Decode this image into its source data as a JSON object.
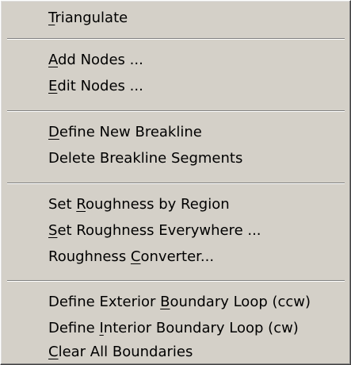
{
  "menu": {
    "items": [
      {
        "pre": "",
        "mn": "T",
        "post": "riangulate"
      },
      {
        "pre": "",
        "mn": "A",
        "post": "dd Nodes ..."
      },
      {
        "pre": "",
        "mn": "E",
        "post": "dit Nodes ..."
      },
      {
        "pre": "",
        "mn": "D",
        "post": "efine New Breakline"
      },
      {
        "pre": "Delete Breakline Segments",
        "mn": "",
        "post": ""
      },
      {
        "pre": "Set ",
        "mn": "R",
        "post": "oughness by Region"
      },
      {
        "pre": "",
        "mn": "S",
        "post": "et Roughness Everywhere ..."
      },
      {
        "pre": "Roughness ",
        "mn": "C",
        "post": "onverter..."
      },
      {
        "pre": "Define Exterior ",
        "mn": "B",
        "post": "oundary Loop (ccw)"
      },
      {
        "pre": "Define ",
        "mn": "I",
        "post": "nterior Boundary Loop (cw)"
      },
      {
        "pre": "",
        "mn": "C",
        "post": "lear All Boundaries"
      }
    ]
  }
}
